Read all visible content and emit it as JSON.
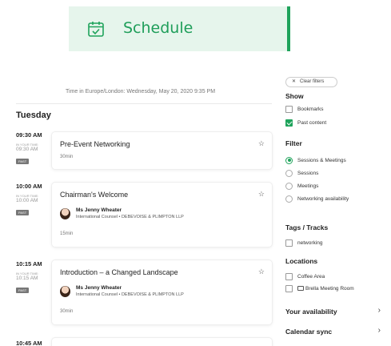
{
  "header": {
    "title": "Schedule",
    "icon": "calendar-check-icon",
    "accent": "#1fa35b",
    "banner_bg": "#e6f5ec"
  },
  "timezone_note": "Time in Europe/London: Wednesday, May 20, 2020 9:35 PM",
  "day_label": "Tuesday",
  "slots": [
    {
      "time": "09:30 AM",
      "your_time_label": "IN YOUR TIME:",
      "your_time": "09:30 AM",
      "badge": "PAST"
    },
    {
      "time": "10:00 AM",
      "your_time_label": "IN YOUR TIME:",
      "your_time": "10:00 AM",
      "badge": "PAST"
    },
    {
      "time": "10:15 AM",
      "your_time_label": "IN YOUR TIME:",
      "your_time": "10:15 AM",
      "badge": "PAST"
    },
    {
      "time": "10:45 AM"
    }
  ],
  "sessions": [
    {
      "title": "Pre-Event Networking",
      "duration": "30min"
    },
    {
      "title": "Chairman's Welcome",
      "speaker_name": "Ms Jenny Wheater",
      "speaker_role": "International Counsel • DEBEVOISE & PLIMPTON LLP",
      "duration": "15min"
    },
    {
      "title": "Introduction – a Changed Landscape",
      "speaker_name": "Ms Jenny Wheater",
      "speaker_role": "International Counsel • DEBEVOISE & PLIMPTON LLP",
      "duration": "30min"
    }
  ],
  "filters": {
    "clear_label": "Clear filters",
    "show_heading": "Show",
    "show_options": [
      {
        "label": "Bookmarks",
        "checked": false
      },
      {
        "label": "Past content",
        "checked": true
      }
    ],
    "filter_heading": "Filter",
    "filter_options": [
      {
        "label": "Sessions & Meetings",
        "selected": true
      },
      {
        "label": "Sessions",
        "selected": false
      },
      {
        "label": "Meetings",
        "selected": false
      },
      {
        "label": "Networking availability",
        "selected": false
      }
    ],
    "tags_heading": "Tags / Tracks",
    "tags": [
      {
        "label": "networking",
        "checked": false
      }
    ],
    "locations_heading": "Locations",
    "locations": [
      {
        "label": "Coffee Area",
        "checked": false
      },
      {
        "label": "Brella Meeting Room",
        "checked": false
      }
    ],
    "availability_label": "Your availability",
    "calendar_sync_label": "Calendar sync"
  }
}
